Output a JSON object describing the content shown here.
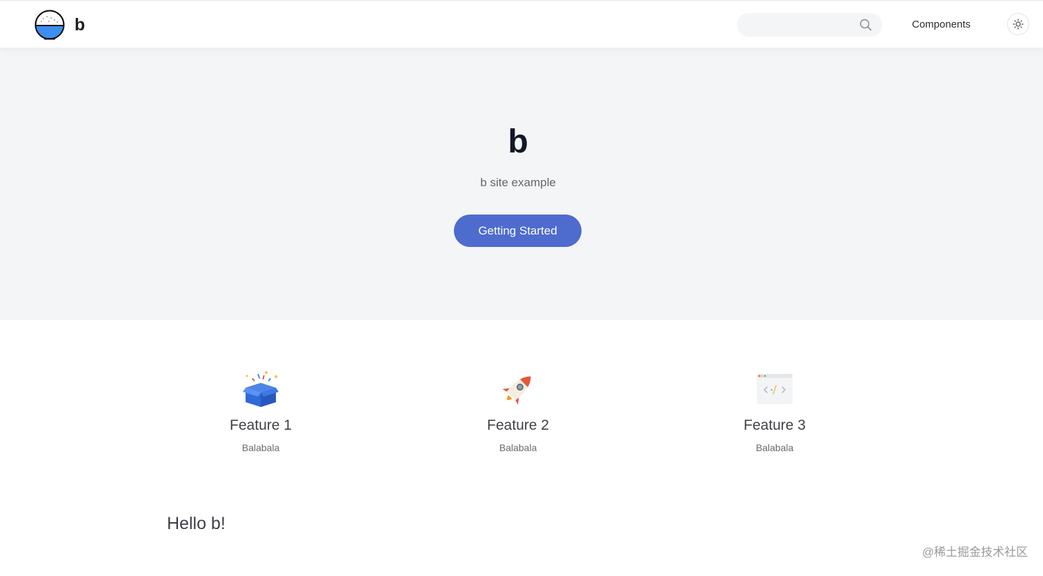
{
  "header": {
    "site_name": "b",
    "search": {
      "placeholder": "",
      "value": ""
    },
    "nav": [
      {
        "label": "Components"
      }
    ]
  },
  "hero": {
    "title": "b",
    "tagline": "b site example",
    "cta_label": "Getting Started",
    "cta_color": "#4e6bce"
  },
  "features": [
    {
      "icon": "gift-box-icon",
      "title": "Feature 1",
      "desc": "Balabala"
    },
    {
      "icon": "rocket-icon",
      "title": "Feature 2",
      "desc": "Balabala"
    },
    {
      "icon": "code-window-icon",
      "title": "Feature 3",
      "desc": "Balabala"
    }
  ],
  "content": {
    "heading": "Hello b!"
  },
  "watermark": "@稀土掘金技术社区"
}
